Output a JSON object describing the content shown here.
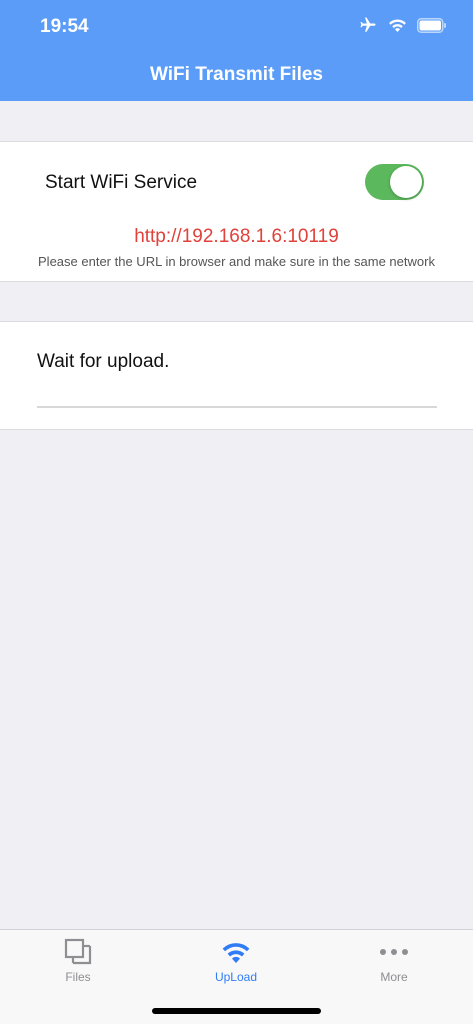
{
  "status_bar": {
    "time": "19:54",
    "icons": [
      "airplane-icon",
      "wifi-icon",
      "battery-icon"
    ]
  },
  "nav": {
    "title": "WiFi Transmit Files"
  },
  "service": {
    "label": "Start WiFi Service",
    "enabled": true,
    "url": "http://192.168.1.6:10119",
    "hint": "Please enter the URL in browser and make sure in the same network"
  },
  "upload": {
    "status": "Wait for upload.",
    "progress": 0
  },
  "tabbar": {
    "tabs": [
      {
        "label": "Files",
        "icon": "files-icon",
        "active": false
      },
      {
        "label": "UpLoad",
        "icon": "wifi-icon",
        "active": true
      },
      {
        "label": "More",
        "icon": "more-icon",
        "active": false
      }
    ]
  },
  "colors": {
    "header": "#5a9cf8",
    "toggle_on": "#5cb85c",
    "url": "#e0413a",
    "tab_active": "#2f7cf6",
    "tab_inactive": "#8e8e93"
  }
}
